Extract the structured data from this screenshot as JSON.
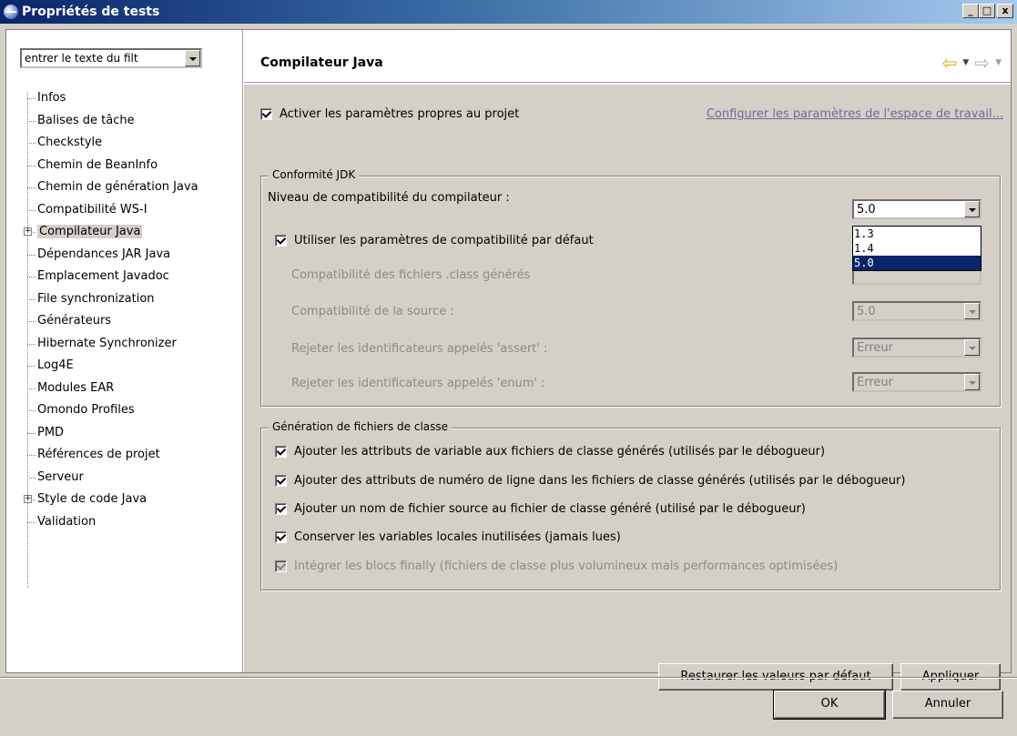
{
  "window": {
    "title": "Propriétés de tests",
    "minimize": "_",
    "maximize": "□",
    "close": "x"
  },
  "filter": {
    "value": "entrer le texte du filt"
  },
  "tree": {
    "items": [
      {
        "label": "Infos"
      },
      {
        "label": "Balises de tâche"
      },
      {
        "label": "Checkstyle"
      },
      {
        "label": "Chemin de BeanInfo"
      },
      {
        "label": "Chemin de génération Java"
      },
      {
        "label": "Compatibilité WS-I"
      },
      {
        "label": "Compilateur Java",
        "expander": "+",
        "selected": true
      },
      {
        "label": "Dépendances JAR Java"
      },
      {
        "label": "Emplacement Javadoc"
      },
      {
        "label": "File synchronization"
      },
      {
        "label": "Générateurs"
      },
      {
        "label": "Hibernate Synchronizer"
      },
      {
        "label": "Log4E"
      },
      {
        "label": "Modules EAR"
      },
      {
        "label": "Omondo Profiles"
      },
      {
        "label": "PMD"
      },
      {
        "label": "Références de projet"
      },
      {
        "label": "Serveur"
      },
      {
        "label": "Style de code Java",
        "expander": "+"
      },
      {
        "label": "Validation"
      }
    ]
  },
  "header": {
    "title": "Compilateur Java",
    "back_icon": "back-arrow-icon",
    "forward_icon": "forward-arrow-icon"
  },
  "project": {
    "enable_label": "Activer les paramètres propres au projet",
    "configure_link": "Configurer les paramètres de l'espace de travail..."
  },
  "jdk": {
    "legend": "Conformité JDK",
    "compliance_label": "Niveau de compatibilité du compilateur :",
    "compliance_value": "5.0",
    "compliance_options": [
      "1.3",
      "1.4",
      "5.0"
    ],
    "use_default_label": "Utiliser les paramètres de compatibilité par défaut",
    "class_compat_label": "Compatibilité des fichiers .class générés",
    "source_compat_label": "Compatibilité de la source :",
    "source_compat_value": "5.0",
    "assert_label": "Rejeter les identificateurs appelés 'assert' :",
    "assert_value": "Erreur",
    "enum_label": "Rejeter les identificateurs appelés 'enum' :",
    "enum_value": "Erreur"
  },
  "classgen": {
    "legend": "Génération de fichiers de classe",
    "options": [
      "Ajouter les attributs de variable aux fichiers de classe générés (utilisés par le débogueur)",
      "Ajouter des attributs de numéro de ligne dans les fichiers de classe générés (utilisés par le débogueur)",
      "Ajouter un nom de fichier source au fichier de classe généré (utilisé par le débogueur)",
      "Conserver les variables locales inutilisées (jamais lues)",
      "Intégrer les blocs finally (fichiers de classe plus volumineux mais performances optimisées)"
    ]
  },
  "buttons": {
    "restore": "Restaurer les valeurs par défaut",
    "apply": "Appliquer",
    "ok": "OK",
    "cancel": "Annuler"
  }
}
